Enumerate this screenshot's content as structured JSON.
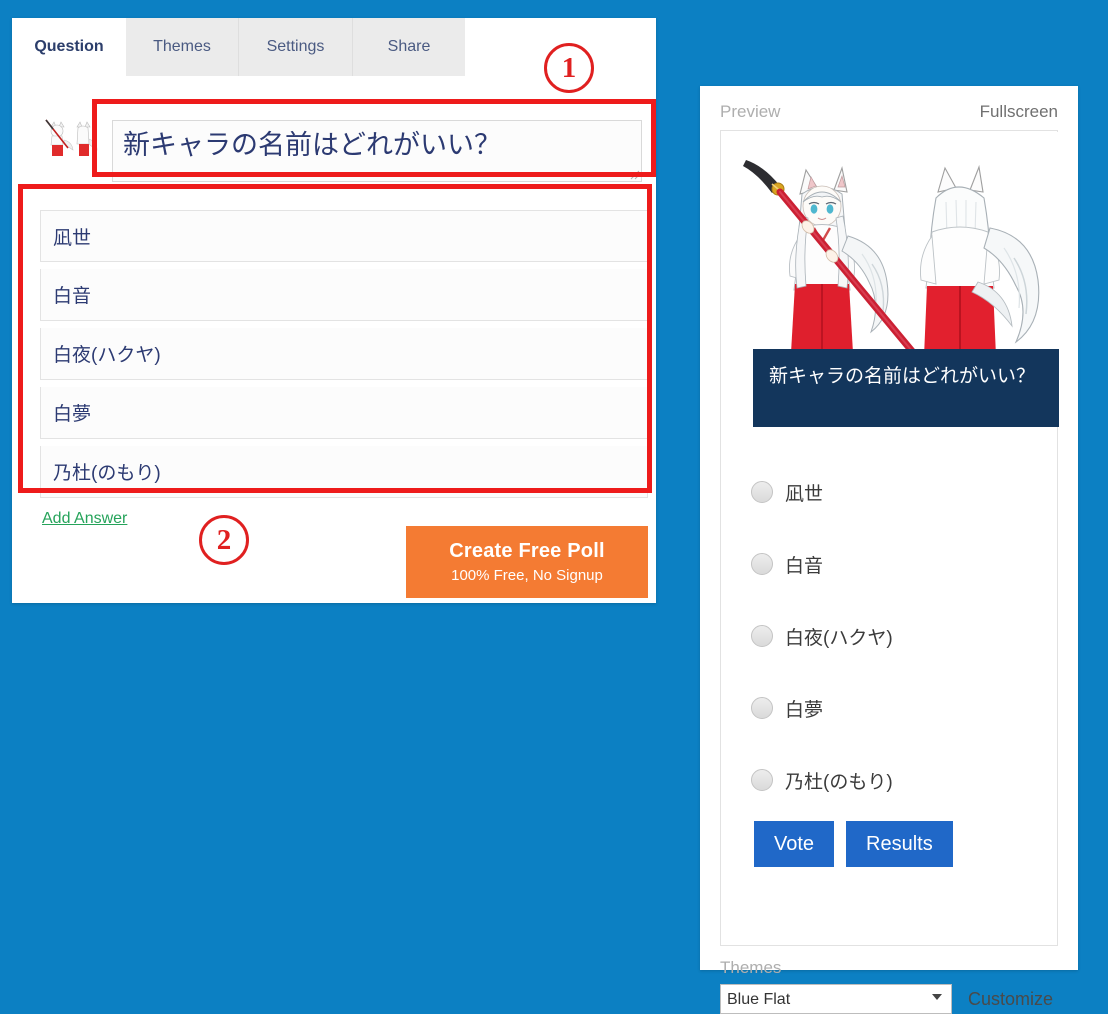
{
  "app": {
    "background_color": "#0c80c3"
  },
  "editor": {
    "tabs": [
      {
        "label": "Question",
        "active": true
      },
      {
        "label": "Themes",
        "active": false
      },
      {
        "label": "Settings",
        "active": false
      },
      {
        "label": "Share",
        "active": false
      }
    ],
    "question": {
      "value": "新キャラの名前はどれがいい？",
      "placeholder": "Ask your question"
    },
    "answers": [
      {
        "value": "凪世",
        "placeholder": "Answer 1"
      },
      {
        "value": "白音",
        "placeholder": "Answer 2"
      },
      {
        "value": "白夜(ハクヤ)",
        "placeholder": "Answer 3"
      },
      {
        "value": "白夢",
        "placeholder": "Answer 4"
      },
      {
        "value": "乃杜(のもり)",
        "placeholder": "Answer 5"
      }
    ],
    "add_answer_label": "Add Answer",
    "create_button": {
      "title": "Create Free Poll",
      "subtitle": "100% Free, No Signup",
      "color": "#f47b33"
    }
  },
  "preview": {
    "label": "Preview",
    "fullscreen_label": "Fullscreen",
    "poll": {
      "title": "新キャラの名前はどれがいい？",
      "title_bar_color": "#13365c",
      "options": [
        {
          "label": "凪世"
        },
        {
          "label": "白音"
        },
        {
          "label": "白夜(ハクヤ)"
        },
        {
          "label": "白夢"
        },
        {
          "label": "乃杜(のもり)"
        }
      ],
      "vote_label": "Vote",
      "results_label": "Results",
      "button_color": "#2068c8"
    },
    "themes": {
      "label": "Themes",
      "selected": "Blue Flat",
      "options": [
        "Blue Flat"
      ],
      "customize_label": "Customize"
    }
  },
  "annotations": {
    "marker_1": "①",
    "marker_2": "②",
    "color": "#ee1b1b"
  }
}
